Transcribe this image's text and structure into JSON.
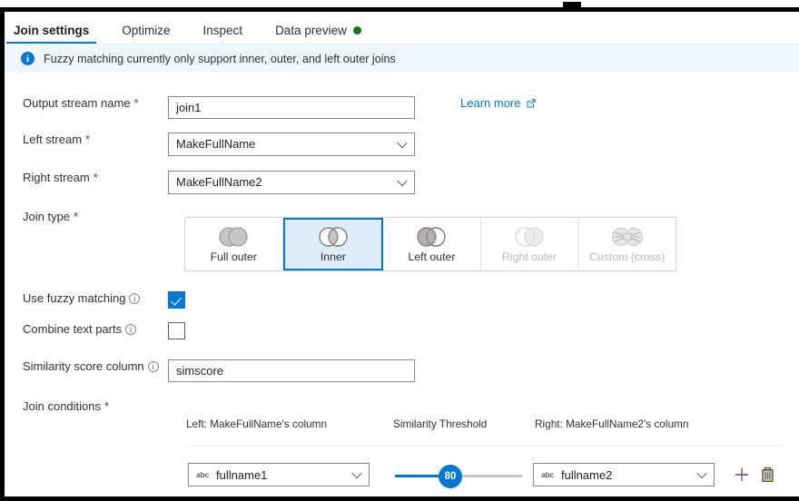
{
  "tabs": [
    {
      "label": "Join settings",
      "active": true,
      "dot": false
    },
    {
      "label": "Optimize",
      "active": false,
      "dot": false
    },
    {
      "label": "Inspect",
      "active": false,
      "dot": false
    },
    {
      "label": "Data preview",
      "active": false,
      "dot": true
    }
  ],
  "info_bar": {
    "icon": "info-icon",
    "glyph": "i",
    "message": "Fuzzy matching currently only support inner, outer, and left outer joins"
  },
  "fields": {
    "output_stream": {
      "label": "Output stream name",
      "required": "*",
      "value": "join1"
    },
    "left_stream": {
      "label": "Left stream",
      "required": "*",
      "value": "MakeFullName"
    },
    "right_stream": {
      "label": "Right stream",
      "required": "*",
      "value": "MakeFullName2"
    },
    "join_type": {
      "label": "Join type",
      "required": "*"
    },
    "use_fuzzy_matching": {
      "label": "Use fuzzy matching",
      "checked": true
    },
    "combine_text_parts": {
      "label": "Combine text parts",
      "checked": false
    },
    "similarity_score_column": {
      "label": "Similarity score column",
      "value": "simscore"
    },
    "join_conditions": {
      "label": "Join conditions",
      "required": "*"
    }
  },
  "learn_more": {
    "label": "Learn more",
    "icon": "external-link-icon"
  },
  "join_types": [
    {
      "id": "full-outer",
      "label": "Full outer",
      "selected": false,
      "disabled": false
    },
    {
      "id": "inner",
      "label": "Inner",
      "selected": true,
      "disabled": false
    },
    {
      "id": "left-outer",
      "label": "Left outer",
      "selected": false,
      "disabled": false
    },
    {
      "id": "right-outer",
      "label": "Right outer",
      "selected": false,
      "disabled": true
    },
    {
      "id": "custom-cross",
      "label": "Custom (cross)",
      "selected": false,
      "disabled": true
    }
  ],
  "conditions_table": {
    "headers": {
      "left": "Left: MakeFullName's column",
      "similarity": "Similarity Threshold",
      "right": "Right: MakeFullName2's column"
    },
    "rows": [
      {
        "left_column": "fullname1",
        "left_type": "abc",
        "threshold": "80",
        "threshold_min": 0,
        "threshold_max": 100,
        "right_column": "fullname2",
        "right_type": "abc",
        "add_icon": "plus-icon",
        "delete_icon": "trash-icon"
      }
    ]
  },
  "colors": {
    "accent": "#0078d4",
    "info_bg": "#eff6fc",
    "selected_tile_bg": "#deecf9",
    "required_asterisk": "#a4262c",
    "status_dot": "#107c10",
    "disabled_text": "#bdbab8"
  }
}
